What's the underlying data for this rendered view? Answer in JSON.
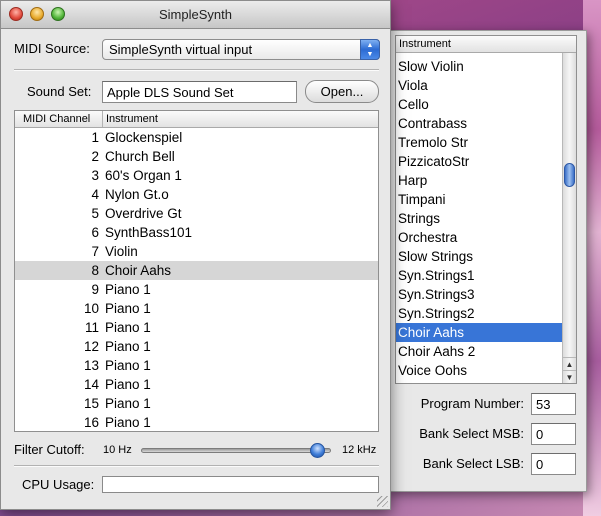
{
  "window": {
    "title": "SimpleSynth"
  },
  "midi_source": {
    "label": "MIDI Source:",
    "value": "SimpleSynth virtual input"
  },
  "sound_set": {
    "label": "Sound Set:",
    "value": "Apple DLS Sound Set",
    "open_button": "Open..."
  },
  "channel_table": {
    "headers": {
      "channel": "MIDI Channel",
      "instrument": "Instrument"
    },
    "selected_channel": 8,
    "rows": [
      {
        "channel": "1",
        "instrument": "Glockenspiel"
      },
      {
        "channel": "2",
        "instrument": "Church Bell"
      },
      {
        "channel": "3",
        "instrument": "60's Organ 1"
      },
      {
        "channel": "4",
        "instrument": "Nylon Gt.o"
      },
      {
        "channel": "5",
        "instrument": "Overdrive Gt"
      },
      {
        "channel": "6",
        "instrument": "SynthBass101"
      },
      {
        "channel": "7",
        "instrument": "Violin"
      },
      {
        "channel": "8",
        "instrument": "Choir Aahs"
      },
      {
        "channel": "9",
        "instrument": "Piano 1"
      },
      {
        "channel": "10",
        "instrument": "Piano 1"
      },
      {
        "channel": "11",
        "instrument": "Piano 1"
      },
      {
        "channel": "12",
        "instrument": "Piano 1"
      },
      {
        "channel": "13",
        "instrument": "Piano 1"
      },
      {
        "channel": "14",
        "instrument": "Piano 1"
      },
      {
        "channel": "15",
        "instrument": "Piano 1"
      },
      {
        "channel": "16",
        "instrument": "Piano 1"
      }
    ]
  },
  "filter_cutoff": {
    "label": "Filter Cutoff:",
    "min_label": "10 Hz",
    "max_label": "12 kHz",
    "position_fraction": 0.96
  },
  "cpu_usage": {
    "label": "CPU Usage:",
    "fraction": 0
  },
  "instrument_panel": {
    "header": "Instrument",
    "selected": "Choir Aahs",
    "items": [
      "Slow Violin",
      "Viola",
      "Cello",
      "Contrabass",
      "Tremolo Str",
      "PizzicatoStr",
      "Harp",
      "Timpani",
      "Strings",
      "Orchestra",
      "Slow Strings",
      "Syn.Strings1",
      "Syn.Strings3",
      "Syn.Strings2",
      "Choir Aahs",
      "Choir Aahs 2",
      "Voice Oohs"
    ],
    "program_number": {
      "label": "Program Number:",
      "value": "53"
    },
    "bank_msb": {
      "label": "Bank Select MSB:",
      "value": "0"
    },
    "bank_lsb": {
      "label": "Bank Select LSB:",
      "value": "0"
    }
  },
  "icons": {
    "popup_arrows": "up-down-chevron-icon",
    "scroll_up": "arrow-up-icon",
    "scroll_down": "arrow-down-icon"
  },
  "colors": {
    "selection_blue": "#3875d7",
    "selected_row_gray": "#d6d6d6",
    "accent_knob": "#3f7ed9"
  }
}
